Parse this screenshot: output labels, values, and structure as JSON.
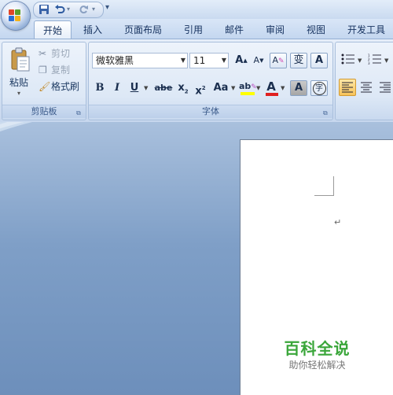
{
  "quick_access": {
    "save_icon": "save-icon",
    "undo_icon": "undo-icon",
    "redo_icon": "redo-icon",
    "customize_icon": "chevron-down-icon"
  },
  "tabs": [
    {
      "label": "开始",
      "active": true
    },
    {
      "label": "插入"
    },
    {
      "label": "页面布局"
    },
    {
      "label": "引用"
    },
    {
      "label": "邮件"
    },
    {
      "label": "审阅"
    },
    {
      "label": "视图"
    },
    {
      "label": "开发工具"
    }
  ],
  "clipboard": {
    "paste_label": "粘贴",
    "cut_label": "剪切",
    "copy_label": "复制",
    "format_painter_label": "格式刷",
    "group_label": "剪贴板"
  },
  "font": {
    "font_name": "微软雅黑",
    "font_size": "11",
    "grow_label": "A",
    "shrink_label": "A",
    "clear_label": "A",
    "phonetic_label": "变",
    "border_label": "A",
    "bold_label": "B",
    "italic_label": "I",
    "underline_label": "U",
    "strike_label": "abe",
    "subscript_label": "x",
    "superscript_label": "x",
    "sub_mark": "2",
    "super_mark": "2",
    "case_label": "Aa",
    "highlight_label": "ab",
    "color_label": "A",
    "shading_label": "A",
    "enclose_label": "字",
    "group_label": "字体",
    "highlight_color": "#ffff00",
    "font_color": "#e02020"
  },
  "document": {
    "watermark_title": "百科全说",
    "watermark_subtitle": "助你轻松解决",
    "paragraph_mark": "↵"
  }
}
